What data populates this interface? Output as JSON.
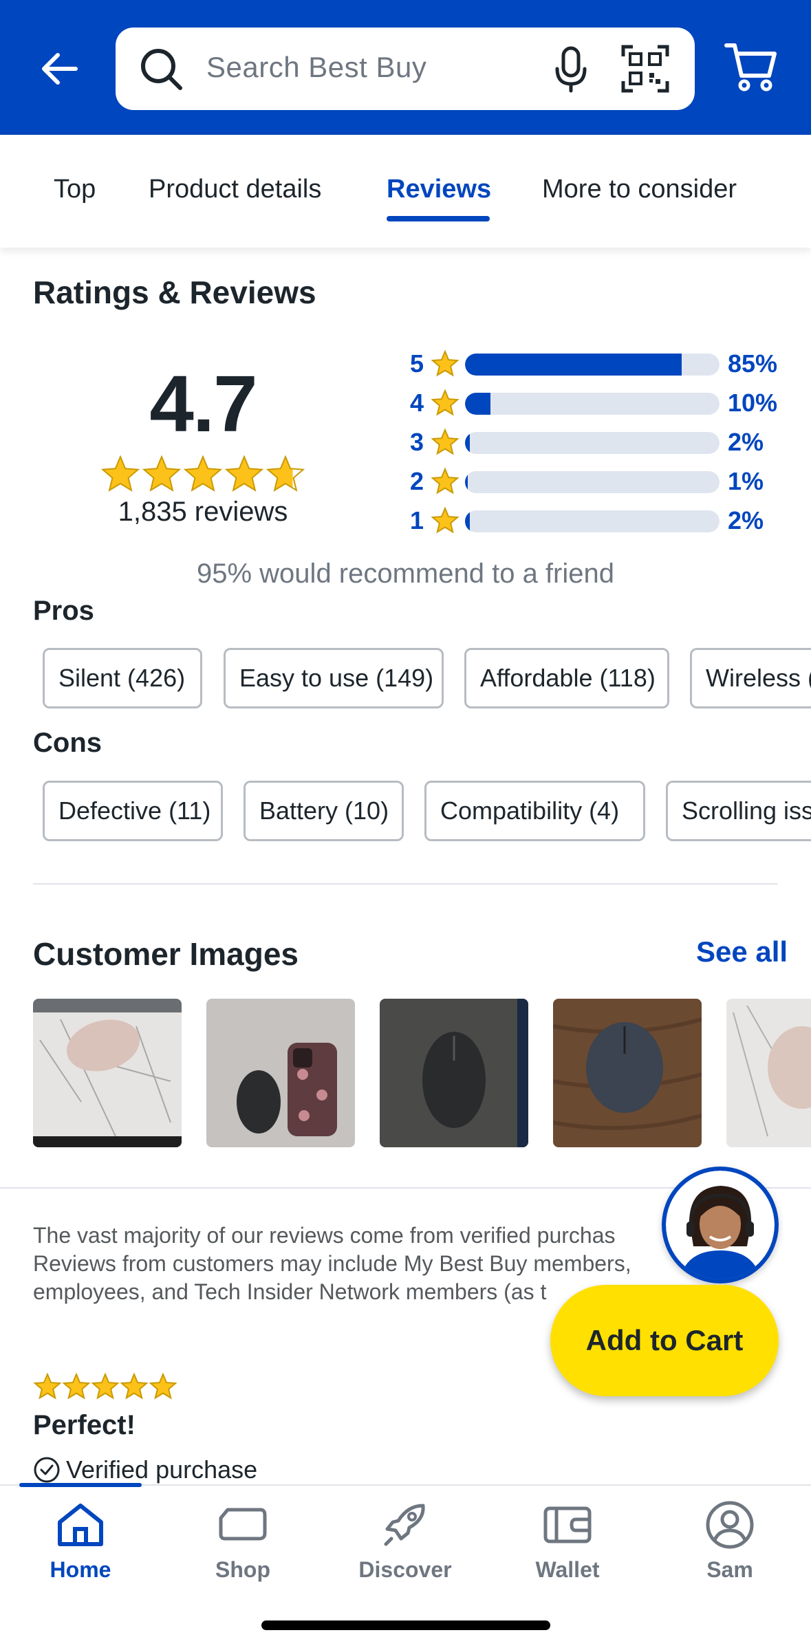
{
  "header": {
    "search_placeholder": "Search Best Buy",
    "brand_color": "#0046be"
  },
  "tabs": [
    {
      "label": "Top"
    },
    {
      "label": "Product details"
    },
    {
      "label": "Reviews",
      "active": true
    },
    {
      "label": "More to consider"
    }
  ],
  "ratings": {
    "title": "Ratings & Reviews",
    "average": "4.7",
    "average_stars": 4.7,
    "count_text": "1,835 reviews",
    "distribution": [
      {
        "stars": "5",
        "percent_text": "85%",
        "percent": 85
      },
      {
        "stars": "4",
        "percent_text": "10%",
        "percent": 10
      },
      {
        "stars": "3",
        "percent_text": "2%",
        "percent": 2
      },
      {
        "stars": "2",
        "percent_text": "1%",
        "percent": 1
      },
      {
        "stars": "1",
        "percent_text": "2%",
        "percent": 2
      }
    ],
    "recommend_text": "95% would recommend to a friend"
  },
  "pros": {
    "label": "Pros",
    "chips": [
      "Silent (426)",
      "Easy to use (149)",
      "Affordable (118)",
      "Wireless ("
    ]
  },
  "cons": {
    "label": "Cons",
    "chips": [
      "Defective (11)",
      "Battery (10)",
      "Compatibility (4)",
      "Scrolling iss"
    ]
  },
  "customer_images": {
    "title": "Customer Images",
    "see_all": "See all",
    "images": [
      "pink-mouse-on-marble-pad",
      "black-mouse-next-to-phone",
      "black-mouse-on-dark-surface",
      "blue-logi-mouse-on-wood",
      "pink-mouse-on-marble"
    ]
  },
  "disclaimer": {
    "lines": [
      "The vast majority of our reviews come from verified purchas",
      "Reviews from customers may include My Best Buy members,",
      "employees, and Tech Insider Network members (as t"
    ]
  },
  "add_to_cart": "Add to Cart",
  "review": {
    "stars": 5,
    "title": "Perfect!",
    "verified": "Verified purchase"
  },
  "bottom_nav": [
    {
      "label": "Home",
      "icon": "home-icon",
      "active": true
    },
    {
      "label": "Shop",
      "icon": "shop-icon"
    },
    {
      "label": "Discover",
      "icon": "discover-icon"
    },
    {
      "label": "Wallet",
      "icon": "wallet-icon"
    },
    {
      "label": "Sam",
      "icon": "profile-icon"
    }
  ],
  "colors": {
    "accent": "#0046be",
    "star": "#fdc21a",
    "cart_button": "#ffe000"
  }
}
